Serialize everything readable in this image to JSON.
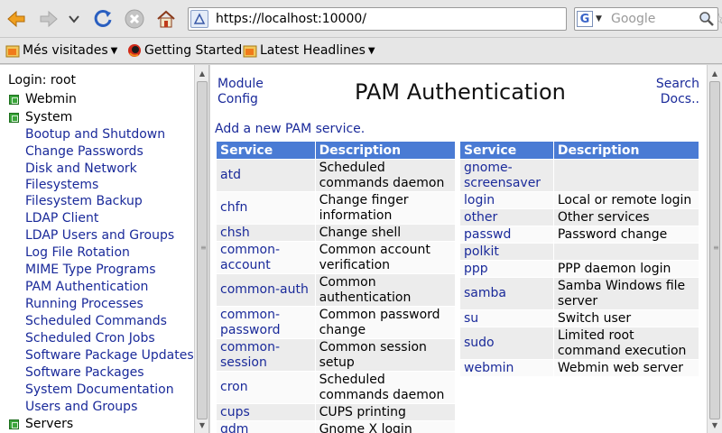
{
  "browser": {
    "url": "https://localhost:10000/",
    "search_placeholder": "Google",
    "bookmarks": [
      {
        "label": "Més visitades",
        "dropdown": true
      },
      {
        "label": "Getting Started",
        "dropdown": false
      },
      {
        "label": "Latest Headlines",
        "dropdown": true
      }
    ]
  },
  "sidebar": {
    "login": "Login: root",
    "cat_webmin": "Webmin",
    "cat_system": "System",
    "cat_servers": "Servers",
    "modules": [
      "Bootup and Shutdown",
      "Change Passwords",
      "Disk and Network Filesystems",
      "Filesystem Backup",
      "LDAP Client",
      "LDAP Users and Groups",
      "Log File Rotation",
      "MIME Type Programs",
      "PAM Authentication",
      "Running Processes",
      "Scheduled Commands",
      "Scheduled Cron Jobs",
      "Software Package Updates",
      "Software Packages",
      "System Documentation",
      "Users and Groups"
    ]
  },
  "main": {
    "module_config": "Module Config",
    "title": "PAM Authentication",
    "search_docs": "Search Docs..",
    "add_link": "Add a new PAM service.",
    "col_service": "Service",
    "col_description": "Description",
    "left_table": [
      {
        "service": "atd",
        "description": "Scheduled commands daemon"
      },
      {
        "service": "chfn",
        "description": "Change finger information"
      },
      {
        "service": "chsh",
        "description": "Change shell"
      },
      {
        "service": "common-account",
        "description": "Common account verification"
      },
      {
        "service": "common-auth",
        "description": "Common authentication"
      },
      {
        "service": "common-password",
        "description": "Common password change"
      },
      {
        "service": "common-session",
        "description": "Common session setup"
      },
      {
        "service": "cron",
        "description": "Scheduled commands daemon"
      },
      {
        "service": "cups",
        "description": "CUPS printing"
      },
      {
        "service": "gdm",
        "description": "Gnome X login"
      }
    ],
    "right_table": [
      {
        "service": "gnome-screensaver",
        "description": ""
      },
      {
        "service": "login",
        "description": "Local or remote login"
      },
      {
        "service": "other",
        "description": "Other services"
      },
      {
        "service": "passwd",
        "description": "Password change"
      },
      {
        "service": "polkit",
        "description": ""
      },
      {
        "service": "ppp",
        "description": "PPP daemon login"
      },
      {
        "service": "samba",
        "description": "Samba Windows file server"
      },
      {
        "service": "su",
        "description": "Switch user"
      },
      {
        "service": "sudo",
        "description": "Limited root command execution"
      },
      {
        "service": "webmin",
        "description": "Webmin web server"
      }
    ]
  }
}
